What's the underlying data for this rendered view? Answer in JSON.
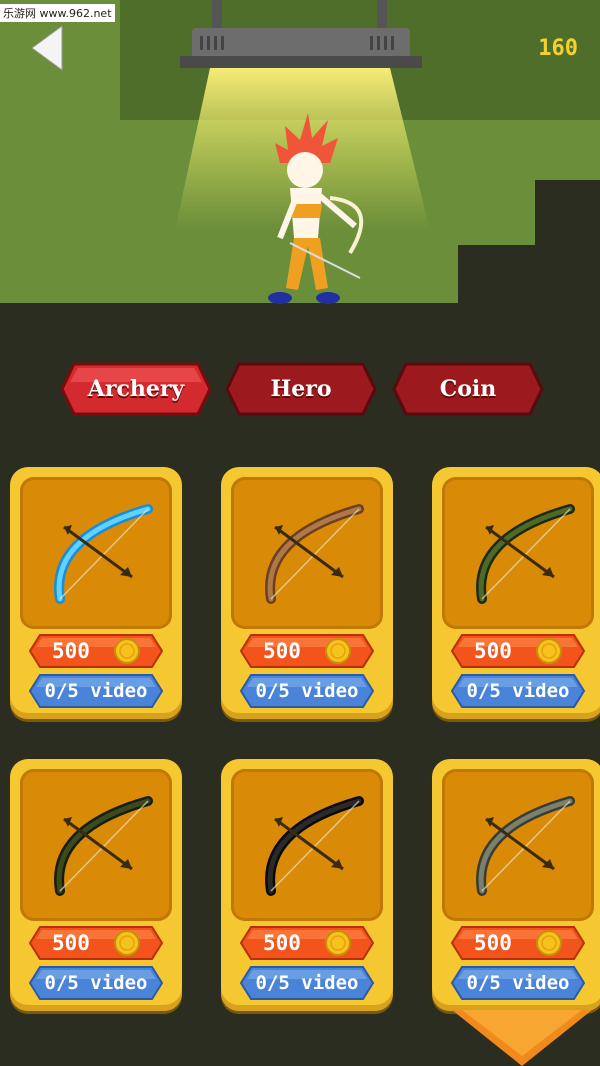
{
  "watermark": "乐游网 www.962.net",
  "header": {
    "coins": "160"
  },
  "tabs": [
    {
      "label": "Archery"
    },
    {
      "label": "Hero"
    },
    {
      "label": "Coin"
    }
  ],
  "cards": [
    {
      "bow": "ice-bow-icon",
      "price": "500",
      "video": "0/5 video"
    },
    {
      "bow": "bronze-bow-icon",
      "price": "500",
      "video": "0/5 video"
    },
    {
      "bow": "jade-bow-icon",
      "price": "500",
      "video": "0/5 video"
    },
    {
      "bow": "dark-green-bow-icon",
      "price": "500",
      "video": "0/5 video"
    },
    {
      "bow": "black-bow-icon",
      "price": "500",
      "video": "0/5 video"
    },
    {
      "bow": "grey-bow-icon",
      "price": "500",
      "video": "0/5 video"
    }
  ],
  "colors": {
    "accent_yellow": "#f5c730",
    "tab_red": "#b3161b",
    "price_orange": "#f2541c",
    "video_blue": "#4a84d8"
  }
}
